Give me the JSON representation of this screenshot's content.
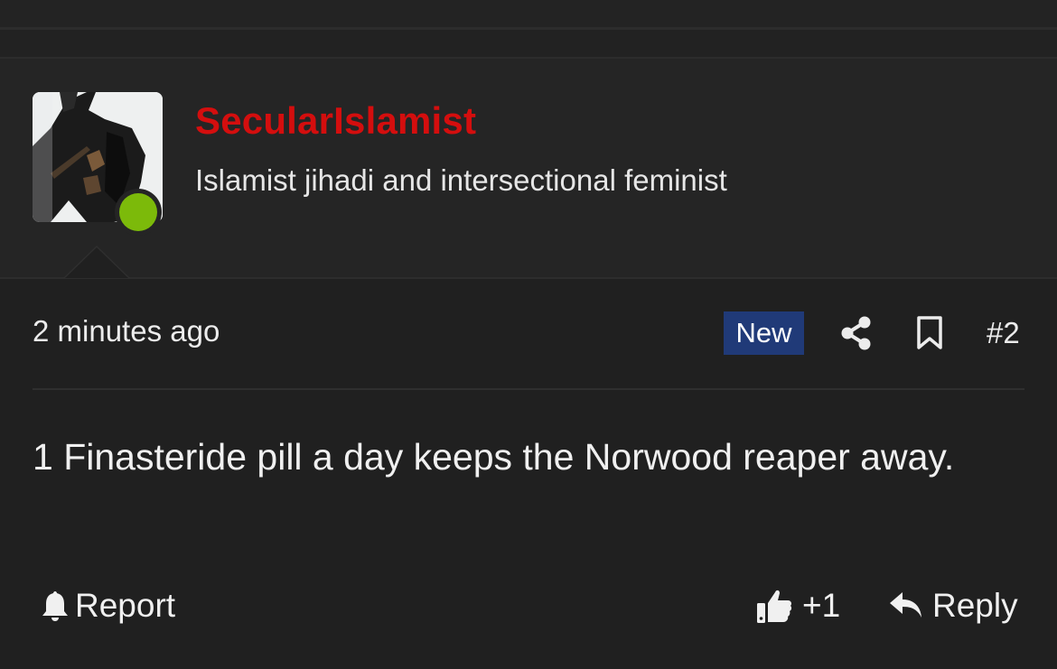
{
  "user": {
    "name": "SecularIslamist",
    "title": "Islamist jihadi and intersectional feminist",
    "online": true,
    "name_color": "#d40e0e",
    "online_color": "#7cba0a"
  },
  "post": {
    "timestamp": "2 minutes ago",
    "badge": "New",
    "badge_color": "#203a78",
    "number": "#2",
    "body": "1 Finasteride pill a day keeps the Norwood reaper away."
  },
  "actions": {
    "report_label": "Report",
    "like_count": "+1",
    "reply_label": "Reply"
  },
  "icons": {
    "share": "share-icon",
    "bookmark": "bookmark-icon",
    "report": "bell-icon",
    "like": "thumbs-up-icon",
    "reply": "reply-arrow-icon"
  }
}
